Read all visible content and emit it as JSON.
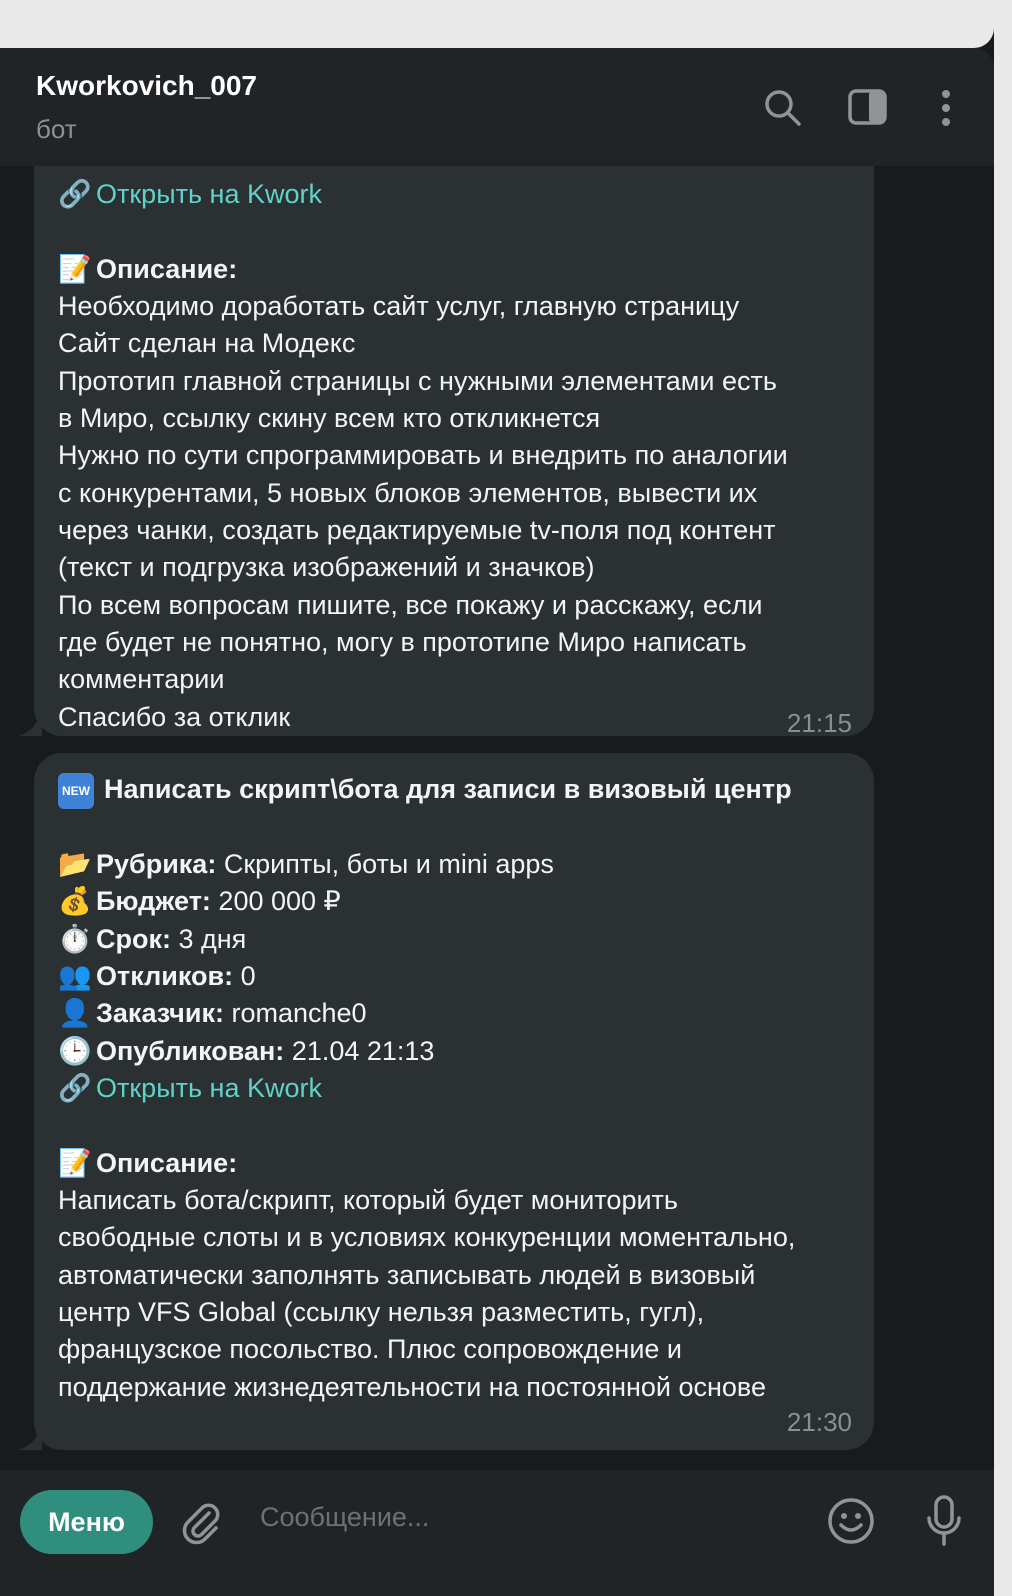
{
  "header": {
    "title": "Kworkovich_007",
    "subtitle": "бот",
    "icons": [
      "search-icon",
      "sidebar-toggle-icon",
      "more-vertical-icon"
    ]
  },
  "message1": {
    "link_emoji": "🔗",
    "link_text": "Открыть на Kwork",
    "desc_emoji": "📝",
    "desc_label": "Описание:",
    "desc_lines": [
      "Необходимо доработать сайт услуг, главную страницу",
      "Сайт сделан на Модекс",
      "Прототип главной страницы с нужными элементами есть",
      "в Миро, ссылку скину всем кто откликнется",
      "Нужно по сути спрограммировать и внедрить по аналогии",
      "с конкурентами, 5 новых блоков элементов, вывести их",
      "через чанки, создать редактируемые tv-поля под контент",
      "(текст и подгрузка изображений и значков)",
      "По всем вопросам пишите, все покажу и расскажу, если",
      "где будет не понятно, могу в прототипе Миро написать",
      "комментарии",
      "Спасибо за отклик"
    ],
    "time": "21:15"
  },
  "message2": {
    "badge": "NEW",
    "title": "Написать скрипт\\бота для записи в визовый центр",
    "fields": [
      {
        "emoji": "📂",
        "label": "Рубрика:",
        "value": " Скрипты, боты и mini apps"
      },
      {
        "emoji": "💰",
        "label": "Бюджет:",
        "value": " 200 000 ₽"
      },
      {
        "emoji": "⏱️",
        "label": "Срок:",
        "value": " 3 дня"
      },
      {
        "emoji": "👥",
        "label": "Откликов:",
        "value": " 0"
      },
      {
        "emoji": "👤",
        "label": "Заказчик:",
        "value": " romanche0"
      },
      {
        "emoji": "🕒",
        "label": "Опубликован:",
        "value": " 21.04 21:13"
      }
    ],
    "link_emoji": "🔗",
    "link_text": "Открыть на Kwork",
    "desc_emoji": "📝",
    "desc_label": "Описание:",
    "desc_lines": [
      "Написать бота/скрипт, который будет мониторить",
      "свободные слоты и в условиях конкуренции моментально,",
      "автоматически заполнять записывать людей в визовый",
      "центр VFS Global (ссылку нельзя разместить, гугл),",
      "французское посольство. Плюс сопровождение и",
      "поддержание жизнедеятельности на постоянной основе"
    ],
    "time": "21:30"
  },
  "composer": {
    "menu_label": "Меню",
    "placeholder": "Сообщение...",
    "icons": [
      "attach-icon",
      "emoji-icon",
      "microphone-icon"
    ]
  },
  "colors": {
    "background": "#171b1e",
    "bubble": "#2b3033",
    "link": "#5fd3c8",
    "menu_button": "#2f8e7e",
    "new_badge": "#3f82d8"
  }
}
